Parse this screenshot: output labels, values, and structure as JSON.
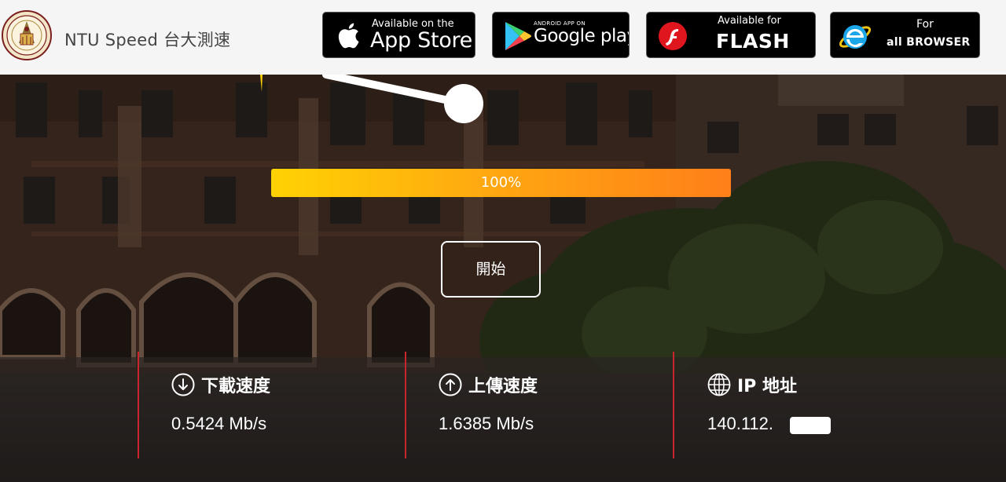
{
  "header": {
    "title": "NTU Speed 台大測速",
    "logo_icon": "ntu-seal-icon",
    "stores": [
      {
        "id": "appstore",
        "small": "Available on the",
        "big": "App Store",
        "icon": "apple-icon"
      },
      {
        "id": "googleplay",
        "small": "ANDROID APP ON",
        "big": "Google play",
        "icon": "google-play-icon"
      },
      {
        "id": "flash",
        "small": "Available for",
        "big": "FLASH",
        "icon": "flash-icon"
      },
      {
        "id": "browser",
        "small": "For",
        "big": "all BROWSER",
        "icon": "internet-explorer-icon"
      }
    ]
  },
  "progress": {
    "label": "100%",
    "value": 1.0
  },
  "start_button": {
    "label": "開始"
  },
  "stats": {
    "download": {
      "label": "下載速度",
      "value": "0.5424 Mb/s",
      "icon": "download-arrow-icon"
    },
    "upload": {
      "label": "上傳速度",
      "value": "1.6385 Mb/s",
      "icon": "upload-arrow-icon"
    },
    "ip": {
      "label": "IP 地址",
      "value": "140.112.",
      "icon": "globe-icon"
    }
  },
  "colors": {
    "progress_start": "#ffd203",
    "progress_end": "#ff7f19",
    "divider": "#c9252c"
  }
}
